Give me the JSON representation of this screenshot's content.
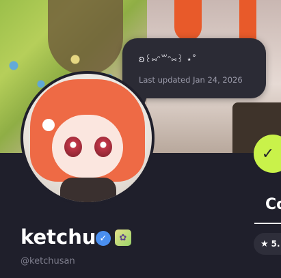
{
  "banner": {
    "alt": "profile-banner"
  },
  "tooltip": {
    "title": "ʚ꒰⑅ᵔ꒳ᵔ⑅꒱ ⋆˚",
    "subtitle": "Last updated Jan 24, 2026"
  },
  "avatar": {
    "icon": "avatar-image"
  },
  "action": {
    "icon": "check-icon",
    "glyph": "✓",
    "color": "#c9f24a"
  },
  "tab": {
    "label": "Co"
  },
  "rating": {
    "star": "★",
    "value": "5."
  },
  "profile": {
    "display_name": "ketchu",
    "verified_glyph": "✓",
    "badge_glyph": "✿",
    "handle": "@ketchusan"
  }
}
